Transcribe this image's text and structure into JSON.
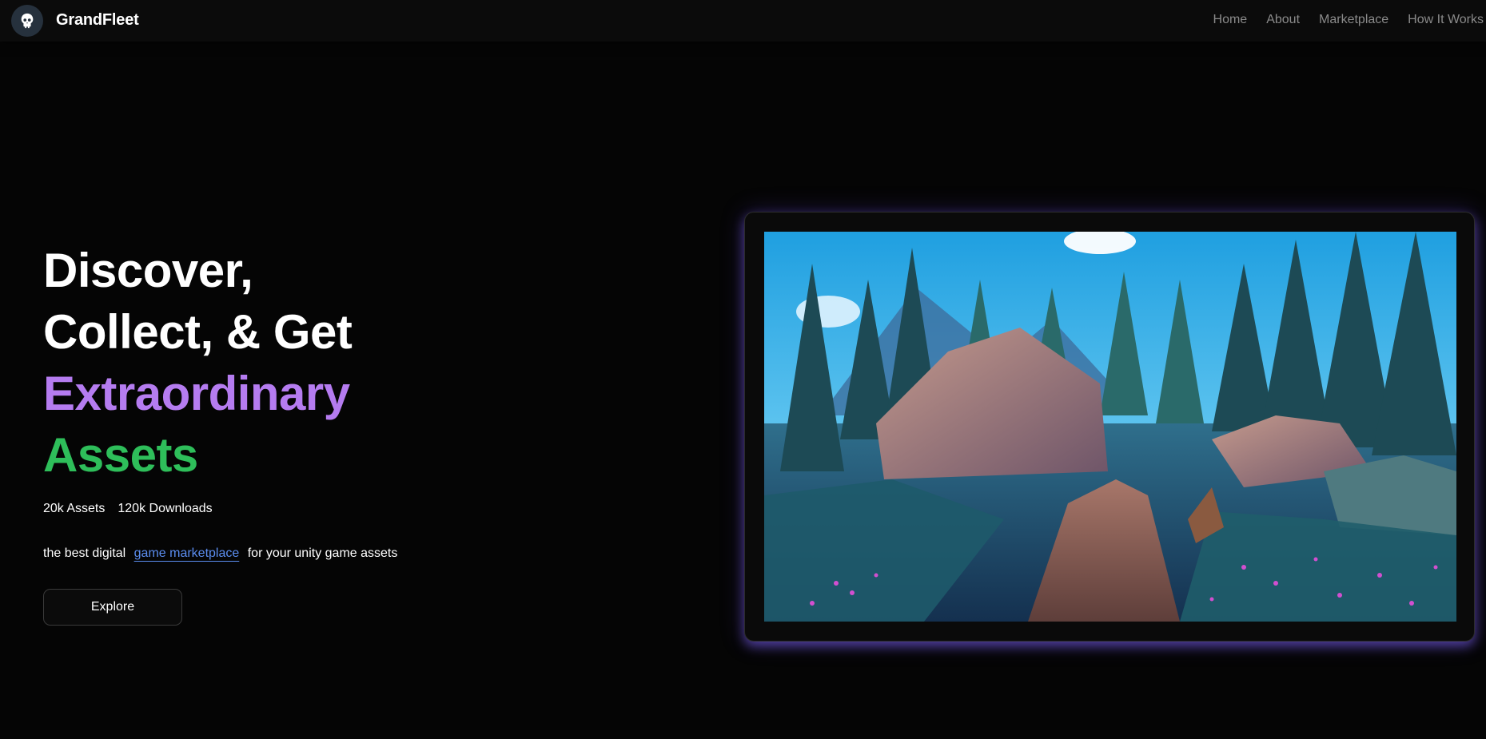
{
  "header": {
    "brand": "GrandFleet",
    "logo_icon": "skull-icon",
    "nav": [
      "Home",
      "About",
      "Marketplace",
      "How It Works"
    ]
  },
  "hero": {
    "title_line1": "Discover,",
    "title_line2": "Collect, & Get",
    "title_line3": "Extraordinary",
    "title_line4": "Assets",
    "stats": [
      "20k Assets",
      "120k Downloads"
    ],
    "tagline_before": "the best digital",
    "tagline_link": "game marketplace",
    "tagline_after": "for your unity game assets",
    "cta_label": "Explore"
  },
  "colors": {
    "accent_purple": "#b57cf0",
    "accent_green": "#2ebe5a",
    "link_blue": "#5b8def",
    "frame_glow": "#7f66ff"
  }
}
